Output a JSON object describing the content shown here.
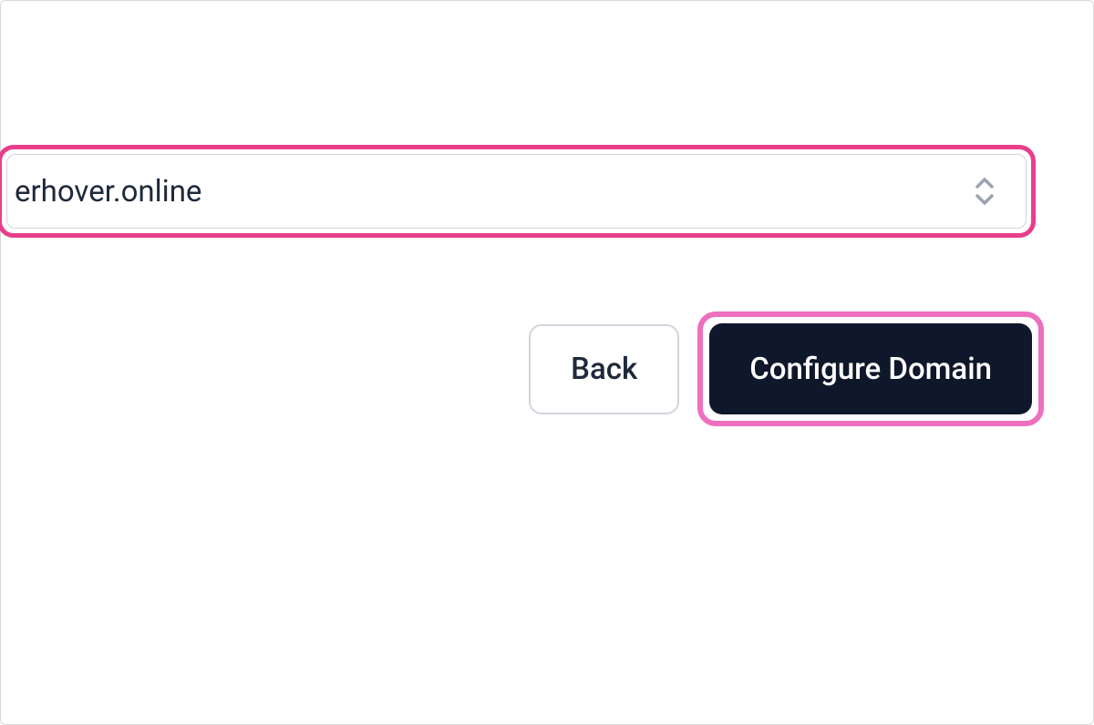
{
  "domain_select": {
    "value": "erhover.online"
  },
  "buttons": {
    "back": "Back",
    "configure": "Configure Domain"
  },
  "colors": {
    "highlight": "#e83e8c",
    "highlight_outer": "#ee6fc0",
    "dark": "#0f172a",
    "text": "#1e293b",
    "border": "#d0d5dd"
  }
}
